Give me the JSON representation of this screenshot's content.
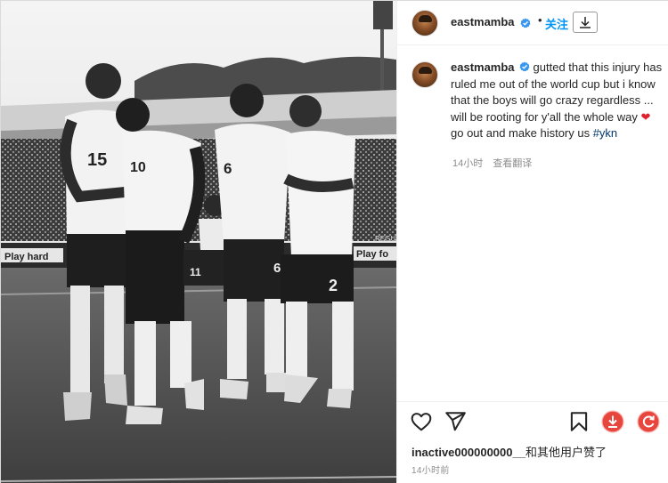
{
  "post": {
    "username": "eastmamba",
    "follow_label": "关注",
    "separator": "•",
    "caption": {
      "text_before_heart": "gutted that this injury has ruled me out of the world cup but i know that the boys will go crazy regardless ... will be rooting for y'all the whole way ",
      "text_after_heart": " go out and make history us ",
      "hashtag": "#ykn",
      "heart_symbol": "❤"
    },
    "caption_time": "14小时",
    "translate_label": "查看翻译",
    "likes": {
      "user": "inactive000000000__",
      "suffix": "和其他用户赞了"
    },
    "post_time": "14小时前"
  },
  "photo": {
    "jersey_numbers": [
      "15",
      "6",
      "2",
      "6",
      "11",
      "10"
    ],
    "board_left": "Play hard",
    "board_right": "Play fo",
    "board_top": "REGUL"
  },
  "icons": {
    "verified": "verified-badge-icon",
    "download": "download-icon",
    "like": "heart-outline-icon",
    "share": "paper-plane-icon",
    "save": "bookmark-icon",
    "ext_download": "red-download-circle-icon",
    "ext_refresh": "red-refresh-circle-icon"
  },
  "colors": {
    "link_blue": "#0095f6",
    "verified_blue": "#3897f0",
    "hashtag": "#00376b",
    "heart_red": "#e0202e",
    "muted": "#8e8e8e",
    "ext_red": "#e8453c"
  }
}
